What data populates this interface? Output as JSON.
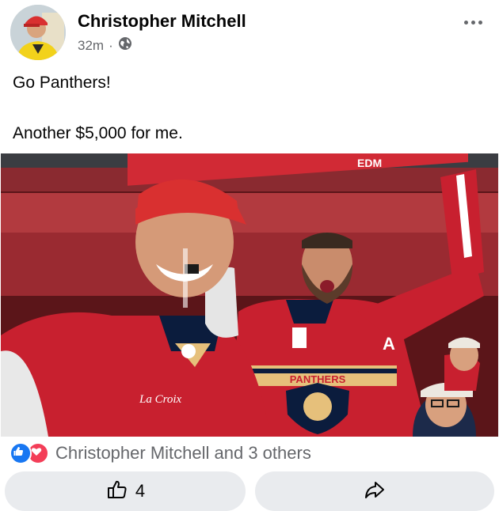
{
  "post": {
    "author": "Christopher Mitchell",
    "time": "32m",
    "separator": "·",
    "text_line1": "Go Panthers!",
    "text_line2": "Another $5,000 for me."
  },
  "photo": {
    "arena_sign": "EDM",
    "jersey_text": "PANTHERS",
    "captain_letter": "A",
    "sponsor_patch": "La Croix"
  },
  "reactions": {
    "summary": "Christopher Mitchell and 3 others",
    "types": [
      "like-icon",
      "love-icon"
    ]
  },
  "actions": {
    "like_count": "4"
  },
  "colors": {
    "like_blue": "#1877f2",
    "love_red": "#f33e58",
    "secondary_text": "#65676b",
    "button_bg": "#e9ebee"
  }
}
